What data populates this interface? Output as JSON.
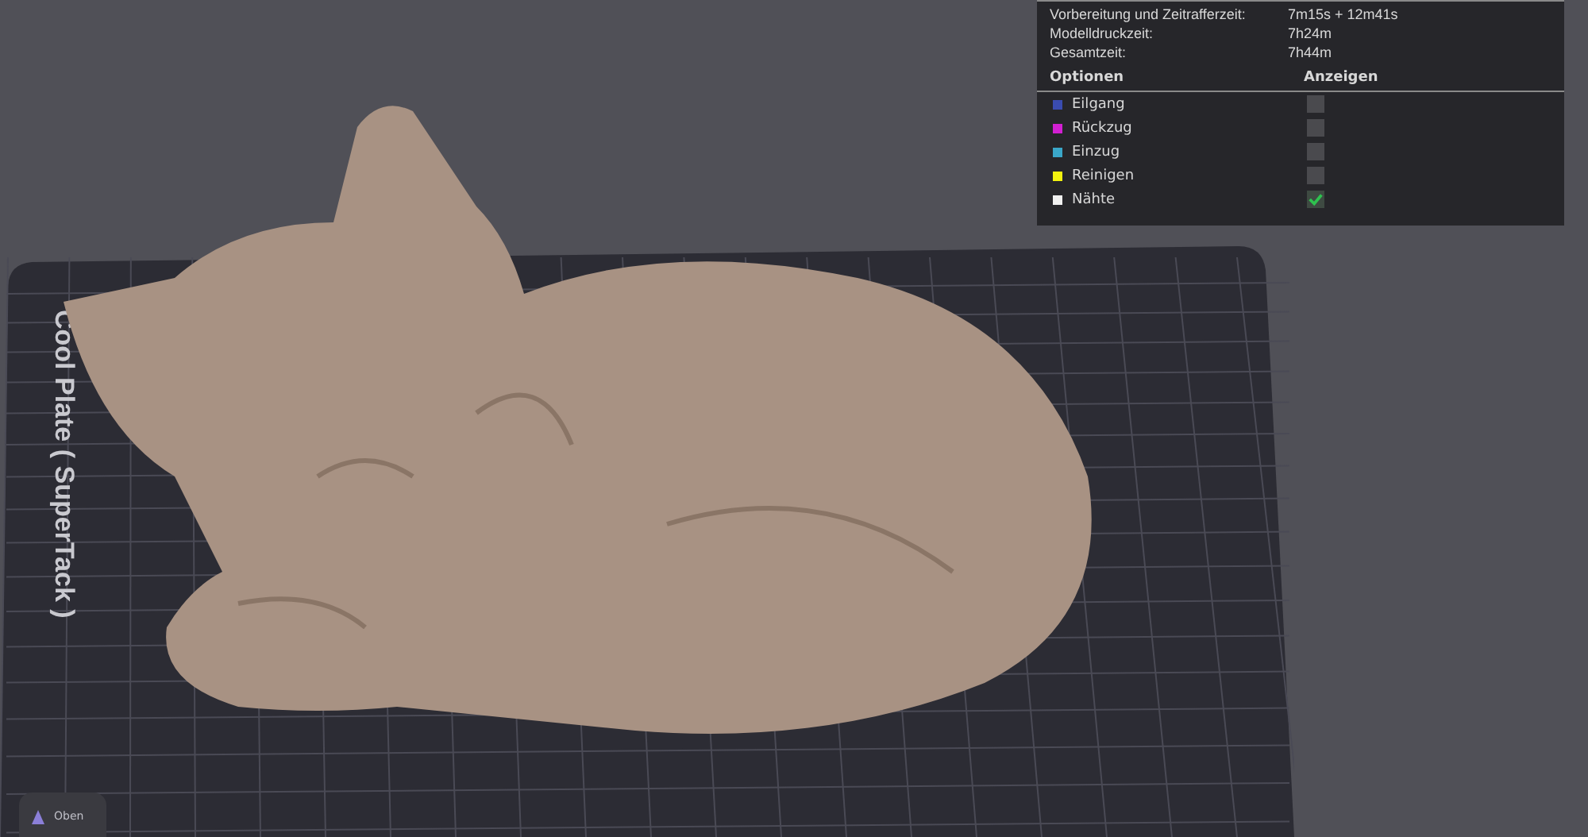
{
  "plate_label": "Cool Plate ( SuperTack )",
  "view_cube": {
    "label": "Oben"
  },
  "summary": [
    {
      "label": "Vorbereitung und Zeitrafferzeit:",
      "value": "7m15s + 12m41s"
    },
    {
      "label": "Modelldruckzeit:",
      "value": "7h24m"
    },
    {
      "label": "Gesamtzeit:",
      "value": "7h44m"
    }
  ],
  "legend": {
    "columns": [
      "Optionen",
      "Anzeigen"
    ],
    "items": [
      {
        "label": "Eilgang",
        "color": "#3a4cb0",
        "checked": false
      },
      {
        "label": "Rückzug",
        "color": "#d21fd2",
        "checked": false
      },
      {
        "label": "Einzug",
        "color": "#3aa7c9",
        "checked": false
      },
      {
        "label": "Reinigen",
        "color": "#f2f20f",
        "checked": false
      },
      {
        "label": "Nähte",
        "color": "#f0f0f0",
        "checked": true
      }
    ]
  }
}
